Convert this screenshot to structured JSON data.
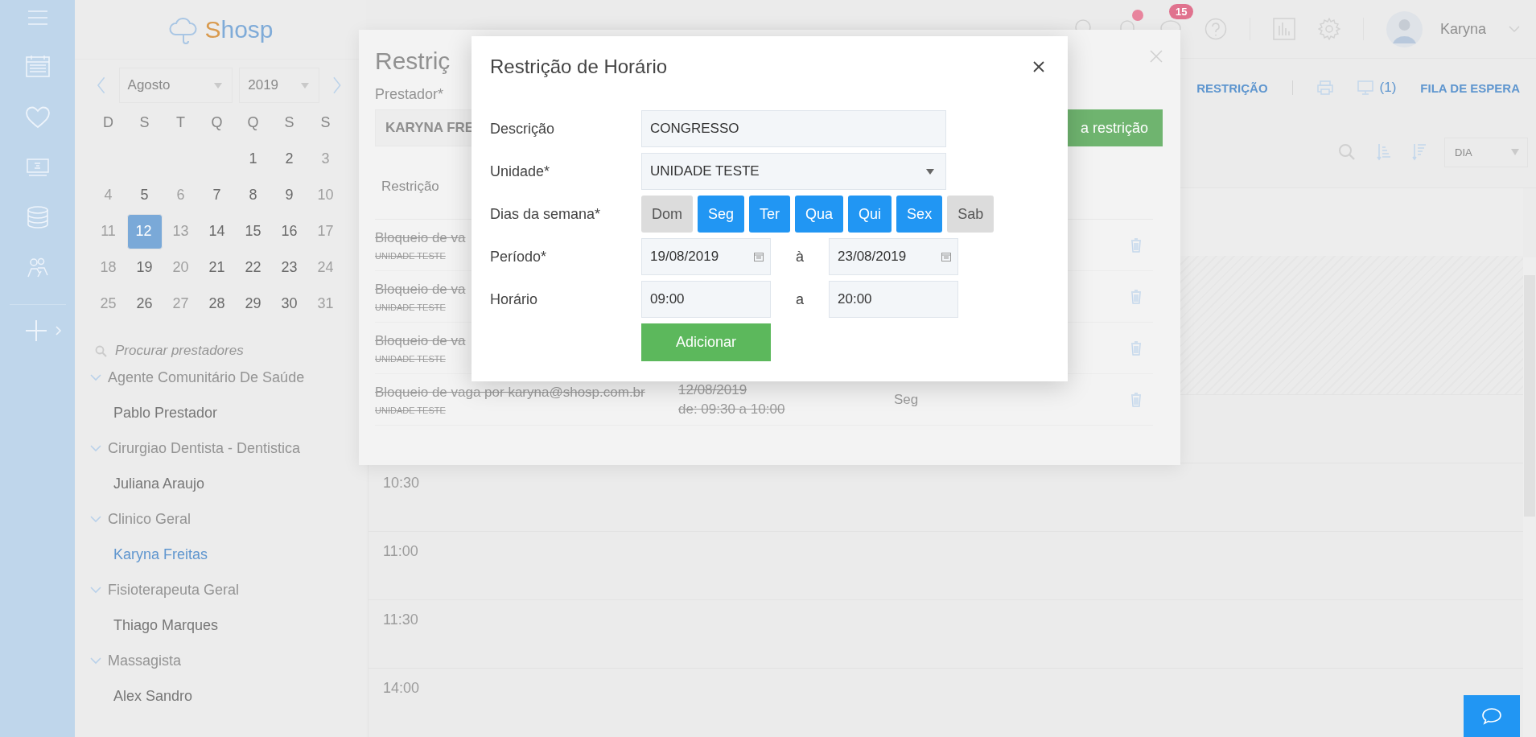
{
  "sidebar": {
    "logo": {
      "initial": "S",
      "rest": "hosp"
    },
    "calendar": {
      "month": "Agosto",
      "year": "2019",
      "weekdays": [
        "D",
        "S",
        "T",
        "Q",
        "Q",
        "S",
        "S"
      ],
      "weeks": [
        [
          {
            "label": "1",
            "muted": false,
            "selected": false
          },
          {
            "label": "2",
            "muted": false,
            "selected": false
          },
          {
            "label": "3",
            "muted": true,
            "selected": false
          }
        ],
        [
          {
            "label": "4",
            "muted": true,
            "selected": false
          },
          {
            "label": "5",
            "muted": false,
            "selected": false
          },
          {
            "label": "6",
            "muted": true,
            "selected": false
          },
          {
            "label": "7",
            "muted": false,
            "selected": false
          },
          {
            "label": "8",
            "muted": false,
            "selected": false
          },
          {
            "label": "9",
            "muted": false,
            "selected": false
          },
          {
            "label": "10",
            "muted": true,
            "selected": false
          }
        ],
        [
          {
            "label": "11",
            "muted": true,
            "selected": false
          },
          {
            "label": "12",
            "muted": false,
            "selected": true
          },
          {
            "label": "13",
            "muted": true,
            "selected": false
          },
          {
            "label": "14",
            "muted": false,
            "selected": false
          },
          {
            "label": "15",
            "muted": false,
            "selected": false
          },
          {
            "label": "16",
            "muted": false,
            "selected": false
          },
          {
            "label": "17",
            "muted": true,
            "selected": false
          }
        ],
        [
          {
            "label": "18",
            "muted": true,
            "selected": false
          },
          {
            "label": "19",
            "muted": false,
            "selected": false
          },
          {
            "label": "20",
            "muted": true,
            "selected": false
          },
          {
            "label": "21",
            "muted": false,
            "selected": false
          },
          {
            "label": "22",
            "muted": false,
            "selected": false
          },
          {
            "label": "23",
            "muted": false,
            "selected": false
          },
          {
            "label": "24",
            "muted": true,
            "selected": false
          }
        ],
        [
          {
            "label": "25",
            "muted": true,
            "selected": false
          },
          {
            "label": "26",
            "muted": false,
            "selected": false
          },
          {
            "label": "27",
            "muted": true,
            "selected": false
          },
          {
            "label": "28",
            "muted": false,
            "selected": false
          },
          {
            "label": "29",
            "muted": false,
            "selected": false
          },
          {
            "label": "30",
            "muted": false,
            "selected": false
          },
          {
            "label": "31",
            "muted": true,
            "selected": false
          }
        ]
      ]
    },
    "search": {
      "placeholder": "Procurar prestadores"
    },
    "groups": [
      {
        "name": "Agente Comunitário De Saúde",
        "expanded": true,
        "children": [
          {
            "name": "Pablo Prestador",
            "selected": false
          }
        ]
      },
      {
        "name": "Cirurgiao Dentista - Dentistica",
        "expanded": true,
        "children": [
          {
            "name": "Juliana Araujo",
            "selected": false
          }
        ]
      },
      {
        "name": "Clinico Geral",
        "expanded": true,
        "children": [
          {
            "name": "Karyna Freitas",
            "selected": true
          }
        ]
      },
      {
        "name": "Fisioterapeuta Geral",
        "expanded": true,
        "children": [
          {
            "name": "Thiago Marques",
            "selected": false
          }
        ]
      },
      {
        "name": "Massagista",
        "expanded": true,
        "children": [
          {
            "name": "Alex Sandro",
            "selected": false
          }
        ]
      }
    ]
  },
  "header": {
    "notification_badge": "15",
    "user": "Karyna"
  },
  "toolbar": {
    "restriction": "RESTRIÇÃO",
    "monitor_count": "(1)",
    "queue": "FILA DE ESPERA",
    "view": "DIA"
  },
  "agenda": {
    "times": [
      "10:30",
      "11:00",
      "11:30",
      "14:00"
    ]
  },
  "restriction_panel": {
    "title": "Restriç",
    "provider_label": "Prestador*",
    "provider_value": "KARYNA FRE",
    "add_button": "a restrição",
    "column": "Restrição",
    "rows": [
      {
        "description": "Bloqueio de va",
        "unit": "UNIDADE TESTE",
        "cancelled": true
      },
      {
        "description": "Bloqueio de va",
        "unit": "UNIDADE TESTE",
        "cancelled": true
      },
      {
        "description": "Bloqueio de va",
        "unit": "UNIDADE TESTE",
        "cancelled": true
      },
      {
        "description": "Bloqueio de vaga por karyna@shosp.com.br",
        "unit": "UNIDADE TESTE",
        "date": "12/08/2019",
        "time": "de: 09:30 a 10:00",
        "days": "Seg",
        "cancelled": true
      }
    ]
  },
  "dialog": {
    "title": "Restrição de Horário",
    "description": {
      "label": "Descrição",
      "value": "CONGRESSO"
    },
    "unit": {
      "label": "Unidade*",
      "value": "UNIDADE TESTE"
    },
    "weekdays": {
      "label": "Dias da semana*",
      "days": [
        {
          "label": "Dom",
          "selected": false
        },
        {
          "label": "Seg",
          "selected": true
        },
        {
          "label": "Ter",
          "selected": true
        },
        {
          "label": "Qua",
          "selected": true
        },
        {
          "label": "Qui",
          "selected": true
        },
        {
          "label": "Sex",
          "selected": true
        },
        {
          "label": "Sab",
          "selected": false
        }
      ]
    },
    "period": {
      "label": "Período*",
      "from": "19/08/2019",
      "separator": "à",
      "to": "23/08/2019"
    },
    "hours": {
      "label": "Horário",
      "from": "09:00",
      "separator": "a",
      "to": "20:00"
    },
    "submit": "Adicionar"
  }
}
